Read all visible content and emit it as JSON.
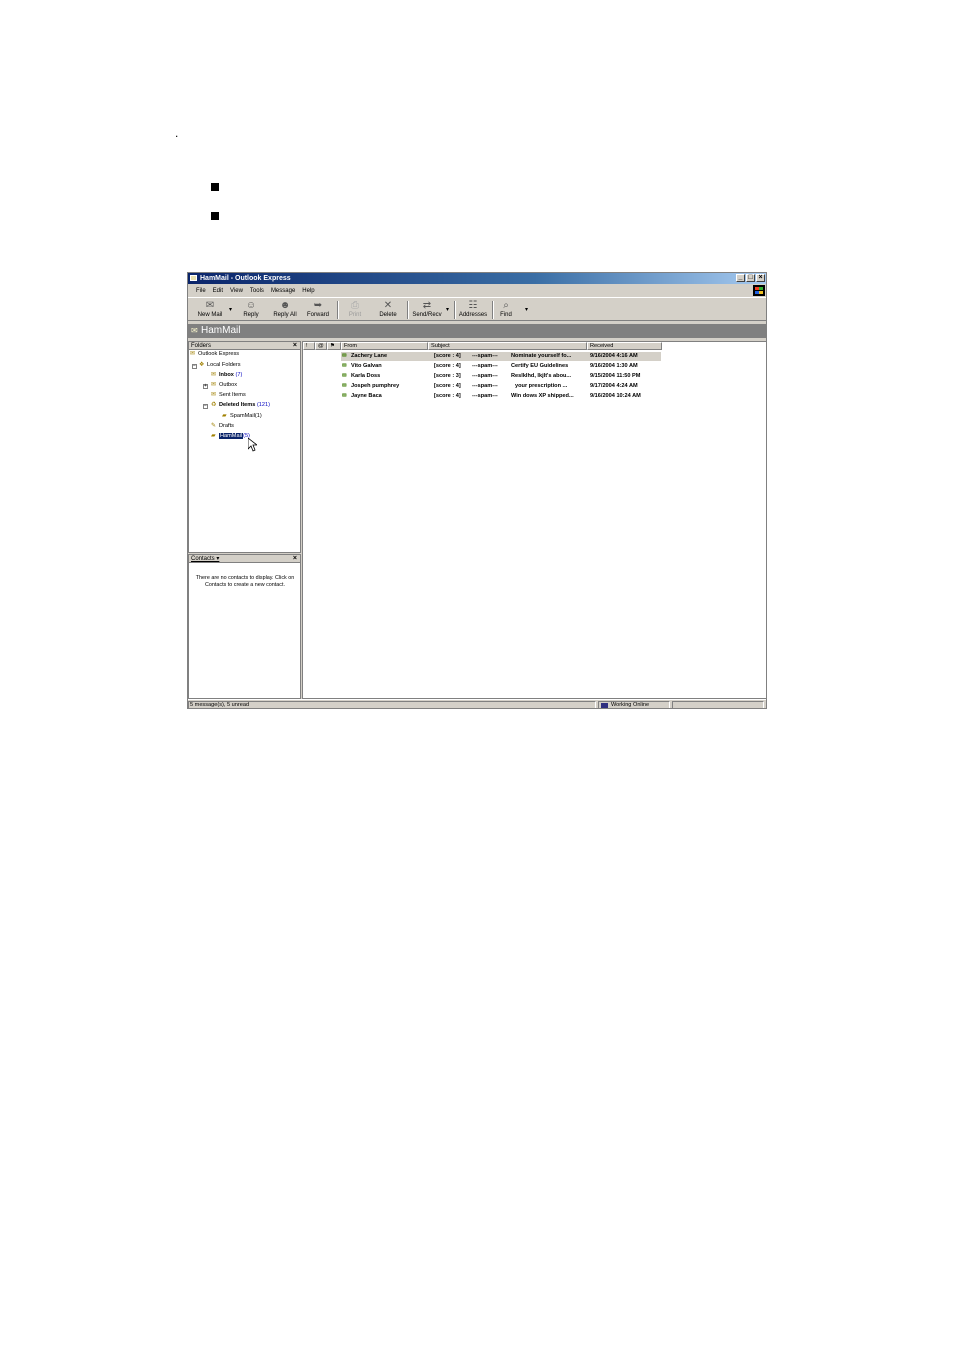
{
  "page": {
    "dot": ".",
    "bullets": [
      "",
      ""
    ]
  },
  "window": {
    "title": "HamMail - Outlook Express",
    "controls": {
      "minimize": "_",
      "maximize": "□",
      "close": "×"
    },
    "menu": [
      "File",
      "Edit",
      "View",
      "Tools",
      "Message",
      "Help"
    ],
    "toolbar": [
      {
        "label": "New Mail",
        "icon": "new-mail-icon",
        "glyph": "✉",
        "dropdown": true,
        "enabled": true
      },
      {
        "label": "Reply",
        "icon": "reply-icon",
        "glyph": "☺",
        "dropdown": false,
        "enabled": true
      },
      {
        "label": "Reply All",
        "icon": "reply-all-icon",
        "glyph": "☻",
        "dropdown": false,
        "enabled": true
      },
      {
        "label": "Forward",
        "icon": "forward-icon",
        "glyph": "➥",
        "dropdown": false,
        "enabled": true
      },
      {
        "label": "Print",
        "icon": "print-icon",
        "glyph": "⎙",
        "dropdown": false,
        "enabled": false
      },
      {
        "label": "Delete",
        "icon": "delete-icon",
        "glyph": "✕",
        "dropdown": false,
        "enabled": true
      },
      {
        "label": "Send/Recv",
        "icon": "send-receive-icon",
        "glyph": "⇄",
        "dropdown": true,
        "enabled": true
      },
      {
        "label": "Addresses",
        "icon": "address-book-icon",
        "glyph": "☷",
        "dropdown": false,
        "enabled": true
      },
      {
        "label": "Find",
        "icon": "find-icon",
        "glyph": "⌕",
        "dropdown": true,
        "enabled": true
      }
    ],
    "folder_banner": "HamMail",
    "folders_pane": {
      "title": "Folders",
      "close": "×",
      "items": [
        {
          "name": "Outlook Express",
          "count": "",
          "bold": false
        },
        {
          "name": "Local Folders",
          "count": "",
          "bold": false
        },
        {
          "name": "Inbox",
          "count": "(7)",
          "bold": true
        },
        {
          "name": "Outbox",
          "count": "",
          "bold": false
        },
        {
          "name": "Sent Items",
          "count": "",
          "bold": false
        },
        {
          "name": "Deleted Items",
          "count": "(121)",
          "bold": true
        },
        {
          "name": "SpamMail",
          "count": "(1)",
          "bold": false
        },
        {
          "name": "Drafts",
          "count": "",
          "bold": false
        },
        {
          "name": "HamMail",
          "count": "(5)",
          "bold": false,
          "selected": true
        }
      ]
    },
    "contacts_pane": {
      "title": "Contacts ▾",
      "close": "×",
      "message": "There are no contacts to display. Click on Contacts to create a new contact."
    },
    "message_list": {
      "columns": {
        "flag1": "!",
        "flag2": "@",
        "flag3": "⚑",
        "from": "From",
        "subject": "Subject",
        "received": "Received"
      },
      "rows": [
        {
          "from": "Zachery Lane",
          "score": "[score : 4]",
          "spam": "---spam---",
          "subject": "Nominate yourself fo...",
          "received": "9/16/2004 4:16 AM"
        },
        {
          "from": "Vito Galvan",
          "score": "[score : 4]",
          "spam": "---spam---",
          "subject": "Certify EU Guidelines",
          "received": "9/16/2004 1:30 AM"
        },
        {
          "from": "Karla Doss",
          "score": "[score : 3]",
          "spam": "---spam---",
          "subject": "Reslklhd, lkjlt's abou...",
          "received": "9/15/2004 11:50 PM"
        },
        {
          "from": "Jospeh pumphrey",
          "score": "[score : 4]",
          "spam": "---spam---",
          "subject": "your prescription ...",
          "received": "9/17/2004 4:24 AM"
        },
        {
          "from": "Jayne Baca",
          "score": "[score : 4]",
          "spam": "---spam---",
          "subject": "Win dows XP shipped...",
          "received": "9/16/2004 10:24 AM"
        }
      ]
    },
    "status": {
      "messages": "5 message(s), 5 unread",
      "connection": "Working Online"
    }
  }
}
